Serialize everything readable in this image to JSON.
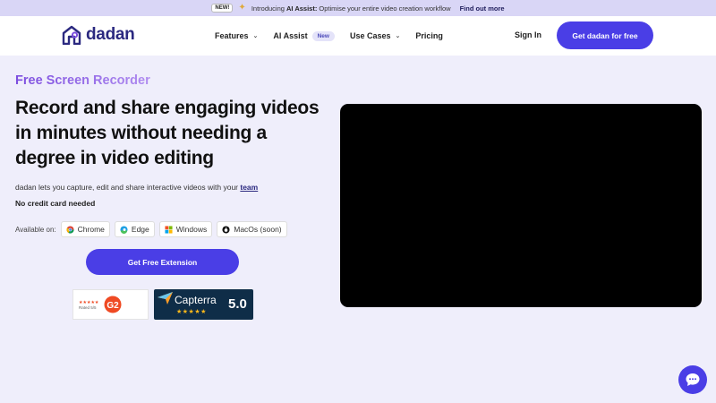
{
  "announcement": {
    "badge": "NEW!",
    "prefix": "Introducing ",
    "highlight": "AI Assist:",
    "text": " Optimise your entire video creation workflow",
    "link": "Find out more"
  },
  "nav": {
    "logo_text": "dadan",
    "links": [
      {
        "label": "Features"
      },
      {
        "label": "AI Assist",
        "badge": "New"
      },
      {
        "label": "Use Cases"
      },
      {
        "label": "Pricing"
      }
    ],
    "signin": "Sign In",
    "cta": "Get dadan for free"
  },
  "hero": {
    "eyebrow": "Free Screen Recorder",
    "headline": "Record and share engaging videos in minutes without needing a degree in video editing",
    "subline_prefix": "dadan lets you capture, edit and share interactive videos with your ",
    "subline_link": "team",
    "no_card": "No credit card needed",
    "available_label": "Available on:",
    "platforms": [
      {
        "label": "Chrome",
        "icon": "chrome-icon"
      },
      {
        "label": "Edge",
        "icon": "edge-icon"
      },
      {
        "label": "Windows",
        "icon": "windows-icon"
      },
      {
        "label": "MacOs (soon)",
        "icon": "apple-icon"
      }
    ],
    "cta": "Get Free Extension"
  },
  "badges": {
    "g2": {
      "stars": "★★★★★",
      "rated": "Rated 5/5",
      "logo": "G2"
    },
    "capterra": {
      "name": "Capterra",
      "stars": "★★★★★",
      "score": "5.0"
    }
  },
  "colors": {
    "accent": "#4a3ee6",
    "brand_dark": "#2b2980",
    "page_bg": "#efeefb",
    "announce_bg": "#d9d6f6"
  }
}
